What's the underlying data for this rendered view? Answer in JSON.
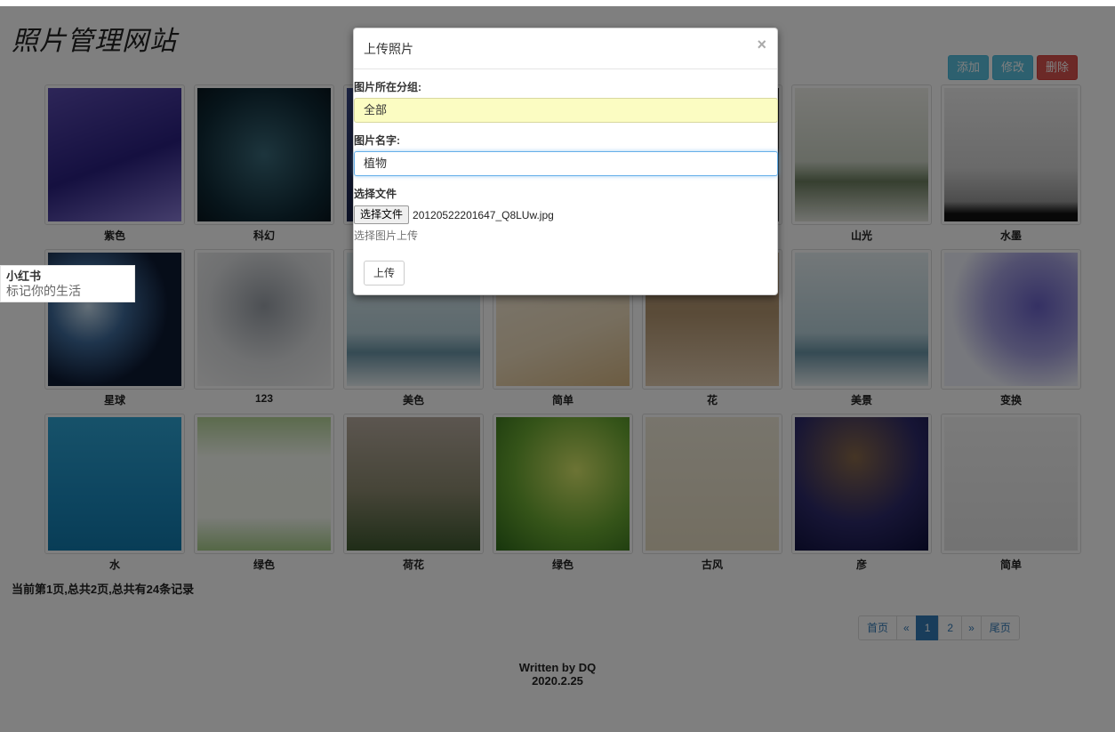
{
  "site": {
    "title": "照片管理网站"
  },
  "actions": {
    "add": "添加",
    "edit": "修改",
    "delete": "删除"
  },
  "photos": [
    {
      "caption": "紫色",
      "grad": "linear-gradient(160deg,#5a4bb0,#2a2080 55%,#8a7cd8)"
    },
    {
      "caption": "科幻",
      "grad": "radial-gradient(circle at 50% 50%,#3a6a7a,#0f2a36 70%,#08161e)"
    },
    {
      "caption": "",
      "grad": "linear-gradient(180deg,#3a4a8a,#1a2550)"
    },
    {
      "caption": "",
      "grad": "linear-gradient(180deg,#e8e8e8,#d8d8d8)"
    },
    {
      "caption": "",
      "grad": "linear-gradient(180deg,#222,#444)"
    },
    {
      "caption": "山光",
      "grad": "linear-gradient(180deg,#f0f0ea,#cfd6c8 55%,#6d7f60 70%,#e4e6df)"
    },
    {
      "caption": "水墨",
      "grad": "linear-gradient(180deg,#efefef,#d4d4d4 60%,#9a9a9a 85%,#111 94%)"
    },
    {
      "caption": "星球",
      "grad": "radial-gradient(circle at 30% 40%,#c8dff0,#3e6a9a 30%,#0d1a33 65%)"
    },
    {
      "caption": "123",
      "grad": "radial-gradient(circle at 50% 40%,#9aa0a8,#dfe1e3 55%,#f4f4f4)"
    },
    {
      "caption": "美色",
      "grad": "linear-gradient(180deg,#e6f0f3,#b9d3dc 60%,#6b96a8 75%,#e9f1f4)"
    },
    {
      "caption": "简单",
      "grad": "linear-gradient(160deg,#f7efe0,#eedcbc 60%,#d9b985)"
    },
    {
      "caption": "花",
      "grad": "linear-gradient(180deg,#c9b08e,#b49670 45%,#e3cdb0)"
    },
    {
      "caption": "美景",
      "grad": "linear-gradient(180deg,#e7f0f3,#b9d3dc 60%,#6b96a8 75%,#e9f1f4)"
    },
    {
      "caption": "变换",
      "grad": "radial-gradient(circle at 70% 40%,#6a62c8,#a5a1e0 40%,#eef0fa 70%)"
    },
    {
      "caption": "水",
      "grad": "linear-gradient(180deg,#2ea4d4,#1b8bc0 60%,#117aad)"
    },
    {
      "caption": "绿色",
      "grad": "linear-gradient(180deg,#b7d69a,#f7fbf2 30%,#f6faf1 75%,#a9cf8c)"
    },
    {
      "caption": "荷花",
      "grad": "linear-gradient(180deg,#b8aca0,#8d8a70 55%,#3f5a30)"
    },
    {
      "caption": "绿色",
      "grad": "radial-gradient(circle at 60% 40%,#d9e86a,#6aa832 55%,#2f6b1a)"
    },
    {
      "caption": "古风",
      "grad": "linear-gradient(180deg,#f0ead9,#e6dcc2)"
    },
    {
      "caption": "彦",
      "grad": "radial-gradient(circle at 45% 30%,#8a6a4a,#2d2a6a 55%,#0d0f3a)"
    },
    {
      "caption": "简单",
      "grad": "linear-gradient(180deg,#f5f5f5,#e6e6e6)"
    }
  ],
  "record_info": "当前第1页,总共2页,总共有24条记录",
  "pagination": {
    "first": "首页",
    "prev": "«",
    "pages": [
      "1",
      "2"
    ],
    "next": "»",
    "last": "尾页",
    "active": "1"
  },
  "footer": {
    "line1": "Written by DQ",
    "line2": "2020.2.25"
  },
  "popup": {
    "title": "小红书",
    "subtitle": "标记你的生活"
  },
  "modal": {
    "title": "上传照片",
    "close": "×",
    "group_label": "图片所在分组:",
    "group_value": "全部",
    "name_label": "图片名字:",
    "name_value": "植物",
    "file_label": "选择文件",
    "file_button": "选择文件",
    "file_name": "20120522201647_Q8LUw.jpg",
    "help": "选择图片上传",
    "upload": "上传"
  }
}
